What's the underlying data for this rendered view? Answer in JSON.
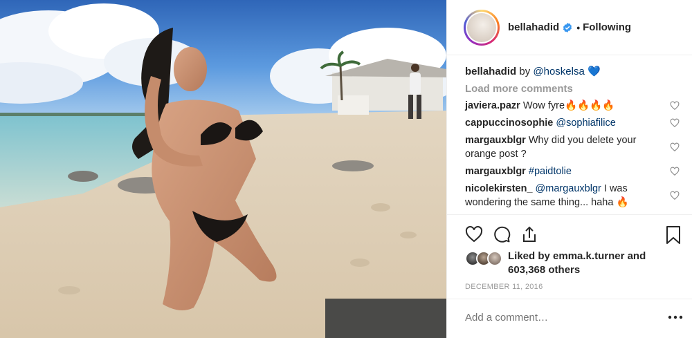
{
  "post": {
    "photo_description_icon": "beach-photo",
    "header": {
      "username": "bellahadid",
      "separator": "•",
      "follow_state": "Following"
    },
    "caption": {
      "username": "bellahadid",
      "text_prefix": "by",
      "mention": "@hoskelsa",
      "emoji": "💙"
    },
    "load_more_label": "Load more comments",
    "comments": [
      {
        "username": "javiera.pazr",
        "text": "Wow fyre🔥🔥🔥🔥"
      },
      {
        "username": "cappuccinosophie",
        "mention": "@sophiafilice",
        "text": ""
      },
      {
        "username": "margauxblgr",
        "text": "Why did you delete your orange post ?"
      },
      {
        "username": "margauxblgr",
        "mention": "#paidtolie",
        "text": ""
      },
      {
        "username": "nicolekirsten_",
        "mention": "@margauxblgr",
        "text": "I was wondering the same thing... haha 🔥"
      }
    ],
    "likes": {
      "prefix": "Liked by",
      "user": "emma.k.turner",
      "conjunction": "and",
      "others": "603,368 others"
    },
    "date": "DECEMBER 11, 2016",
    "add_comment_placeholder": "Add a comment…",
    "colors": {
      "mention": "#003569",
      "verified": "#3897f0",
      "muted": "#999999"
    }
  }
}
